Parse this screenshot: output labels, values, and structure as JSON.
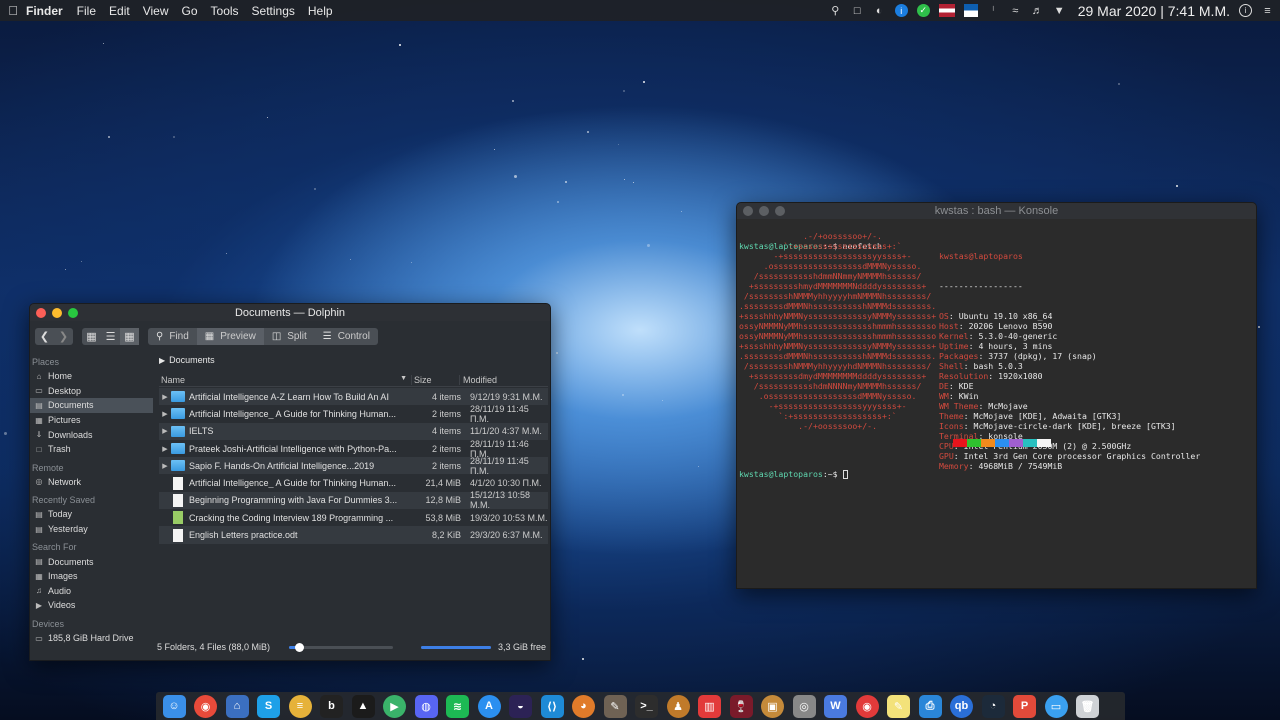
{
  "menubar": {
    "apple_icon": "apple-logo-icon",
    "app_name": "Finder",
    "menus": [
      "File",
      "Edit",
      "View",
      "Go",
      "Tools",
      "Settings",
      "Help"
    ],
    "date": "29 Mar 2020",
    "time": "7:41 M.M."
  },
  "dolphin": {
    "title": "Documents — Dolphin",
    "toolbar": {
      "find": "Find",
      "preview": "Preview",
      "split": "Split",
      "control": "Control"
    },
    "places_title": "Places",
    "places": [
      "Home",
      "Desktop",
      "Documents",
      "Pictures",
      "Downloads",
      "Trash"
    ],
    "remote_title": "Remote",
    "remote": [
      "Network"
    ],
    "recent_title": "Recently Saved",
    "recent": [
      "Today",
      "Yesterday"
    ],
    "search_title": "Search For",
    "search": [
      "Documents",
      "Images",
      "Audio",
      "Videos"
    ],
    "devices_title": "Devices",
    "devices": [
      "185,8 GiB Hard Drive"
    ],
    "breadcrumb": "Documents",
    "columns": {
      "name": "Name",
      "size": "Size",
      "modified": "Modified"
    },
    "rows": [
      {
        "name": "Artificial Intelligence A-Z Learn How To Build An AI",
        "size": "4 items",
        "modified": "9/12/19 9:31 M.M.",
        "type": "folder"
      },
      {
        "name": "Artificial Intelligence_ A Guide for Thinking Human...",
        "size": "2 items",
        "modified": "28/11/19 11:45 Π.Μ.",
        "type": "folder"
      },
      {
        "name": "IELTS",
        "size": "4 items",
        "modified": "11/1/20 4:37 M.M.",
        "type": "folder"
      },
      {
        "name": "Prateek Joshi-Artificial Intelligence with Python-Pa...",
        "size": "2 items",
        "modified": "28/11/19 11:46 Π.Μ.",
        "type": "folder"
      },
      {
        "name": "Sapio F. Hands-On Artificial Intelligence...2019",
        "size": "2 items",
        "modified": "28/11/19 11:45 Π.Μ.",
        "type": "folder"
      },
      {
        "name": "Artificial Intelligence_ A Guide for Thinking Human...",
        "size": "21,4 MiB",
        "modified": "4/1/20 10:30 Π.Μ.",
        "type": "file"
      },
      {
        "name": "Beginning Programming with Java For Dummies 3...",
        "size": "12,8 MiB",
        "modified": "15/12/13 10:58 M.M.",
        "type": "file"
      },
      {
        "name": "Cracking the Coding Interview 189 Programming ...",
        "size": "53,8 MiB",
        "modified": "19/3/20 10:53 M.M.",
        "type": "book"
      },
      {
        "name": "English Letters practice.odt",
        "size": "8,2 KiB",
        "modified": "29/3/20 6:37 M.M.",
        "type": "file"
      }
    ],
    "status": "5 Folders, 4 Files (88,0 MiB)",
    "zoom_level": 0.1,
    "space_used": 1.0,
    "free": "3,3 GiB free"
  },
  "konsole": {
    "title": "kwstas : bash — Konsole",
    "prompt_user": "kwstas@laptoparos",
    "prompt_path": ":~$ ",
    "command": "neofetch",
    "logo": [
      "             .-/+oossssoo+/-.",
      "         `:+ssssssssssssssssss+:`",
      "       -+ssssssssssssssssssyyssss+-",
      "     .ossssssssssssssssssdMMMNysssso.",
      "   /ssssssssssshdmmNNmmyNMMMMhssssss/",
      "  +ssssssssshmydMMMMMMMNddddyssssssss+",
      " /sssssssshNMMMyhhyyyyhmNMMMNhssssssss/",
      ".ssssssssdMMMNhsssssssssshNMMMdssssssss.",
      "+sssshhhyNMMNyssssssssssssyNMMMysssssss+",
      "ossyNMMMNyMMhsssssssssssssshmmmhssssssso",
      "ossyNMMMNyMMhsssssssssssssshmmmhssssssso",
      "+sssshhhyNMMNyssssssssssssyNMMMysssssss+",
      ".ssssssssdMMMNhsssssssssshNMMMdssssssss.",
      " /sssssssshNMMMyhhyyyyhdNMMMNhssssssss/",
      "  +sssssssssdmydMMMMMMMMddddyssssssss+",
      "   /ssssssssssshdmNNNNmyNMMMMhssssss/",
      "    .ossssssssssssssssssdMMMNysssso.",
      "      -+sssssssssssssssssyyyssss+-",
      "        `:+ssssssssssssssssss+:`",
      "            .-/+oossssoo+/-."
    ],
    "host": "kwstas@laptoparos",
    "separator": "-----------------",
    "info": [
      {
        "key": "OS",
        "value": "Ubuntu 19.10 x86_64"
      },
      {
        "key": "Host",
        "value": "20206 Lenovo B590"
      },
      {
        "key": "Kernel",
        "value": "5.3.0-40-generic"
      },
      {
        "key": "Uptime",
        "value": "4 hours, 3 mins"
      },
      {
        "key": "Packages",
        "value": "3737 (dpkg), 17 (snap)"
      },
      {
        "key": "Shell",
        "value": "bash 5.0.3"
      },
      {
        "key": "Resolution",
        "value": "1920x1080"
      },
      {
        "key": "DE",
        "value": "KDE"
      },
      {
        "key": "WM",
        "value": "KWin"
      },
      {
        "key": "WM Theme",
        "value": "McMojave"
      },
      {
        "key": "Theme",
        "value": "McMojave [KDE], Adwaita [GTK3]"
      },
      {
        "key": "Icons",
        "value": "McMojave-circle-dark [KDE], breeze [GTK3]"
      },
      {
        "key": "Terminal",
        "value": "konsole"
      },
      {
        "key": "CPU",
        "value": "Intel Pentium 2030M (2) @ 2.500GHz"
      },
      {
        "key": "GPU",
        "value": "Intel 3rd Gen Core processor Graphics Controller"
      },
      {
        "key": "Memory",
        "value": "4968MiB / 7549MiB"
      }
    ],
    "palette": [
      "#e8141c",
      "#2fc22f",
      "#f08a1d",
      "#2b8ff0",
      "#a05fd0",
      "#29c0c0",
      "#f5f5f5"
    ]
  },
  "dock": [
    {
      "name": "finder",
      "icon": "finder-icon",
      "color": "#3a8fe8",
      "glyph": "☺"
    },
    {
      "name": "chrome",
      "icon": "chrome-icon",
      "color": "#e84a3a",
      "glyph": "◉"
    },
    {
      "name": "system-settings",
      "icon": "settings-app-icon",
      "color": "#3b6fc0",
      "glyph": "⌂"
    },
    {
      "name": "skype",
      "icon": "skype-icon",
      "color": "#1ea0e8",
      "glyph": "S"
    },
    {
      "name": "reader",
      "icon": "reader-icon",
      "color": "#e6b23a",
      "glyph": "≡"
    },
    {
      "name": "dark-app",
      "icon": "app-icon",
      "color": "#222",
      "glyph": "b"
    },
    {
      "name": "inkscape",
      "icon": "inkscape-icon",
      "color": "#1b1b1b",
      "glyph": "▲"
    },
    {
      "name": "media-player",
      "icon": "play-icon",
      "color": "#3ab36a",
      "glyph": "▶"
    },
    {
      "name": "discord",
      "icon": "discord-icon",
      "color": "#5865f2",
      "glyph": "◍"
    },
    {
      "name": "spotify",
      "icon": "spotify-icon",
      "color": "#1db954",
      "glyph": "≋"
    },
    {
      "name": "app-store",
      "icon": "app-store-icon",
      "color": "#2b8ff0",
      "glyph": "A"
    },
    {
      "name": "eclipse",
      "icon": "eclipse-icon",
      "color": "#2c2255",
      "glyph": "◒"
    },
    {
      "name": "vscode",
      "icon": "vscode-icon",
      "color": "#1e8ad6",
      "glyph": "⟨⟩"
    },
    {
      "name": "color-picker",
      "icon": "palette-icon",
      "color": "#e07b2a",
      "glyph": "◕"
    },
    {
      "name": "gimp",
      "icon": "gimp-icon",
      "color": "#6f6254",
      "glyph": "✎"
    },
    {
      "name": "terminal",
      "icon": "terminal-icon",
      "color": "#2d2d2d",
      "glyph": ">_"
    },
    {
      "name": "joystick",
      "icon": "game-icon",
      "color": "#c07a2a",
      "glyph": "♟"
    },
    {
      "name": "popcorn",
      "icon": "popcorn-icon",
      "color": "#e23a3a",
      "glyph": "▥"
    },
    {
      "name": "wine",
      "icon": "wine-icon",
      "color": "#7a1a2a",
      "glyph": "🍷"
    },
    {
      "name": "archive",
      "icon": "archive-icon",
      "color": "#c58a3a",
      "glyph": "▣"
    },
    {
      "name": "disk-utility",
      "icon": "disk-icon",
      "color": "#888",
      "glyph": "◎"
    },
    {
      "name": "word",
      "icon": "word-icon",
      "color": "#4a7ae0",
      "glyph": "W"
    },
    {
      "name": "reader-red",
      "icon": "eye-icon",
      "color": "#e23a3a",
      "glyph": "◉"
    },
    {
      "name": "notes",
      "icon": "notes-icon",
      "color": "#f3e27a",
      "glyph": "✎"
    },
    {
      "name": "scanner",
      "icon": "scanner-icon",
      "color": "#2a86d8",
      "glyph": "⎙"
    },
    {
      "name": "qbittorrent",
      "icon": "qbittorrent-icon",
      "color": "#2a6fd8",
      "glyph": "qb"
    },
    {
      "name": "system-monitor",
      "icon": "monitor-icon",
      "color": "#1c2a3a",
      "glyph": "◔"
    },
    {
      "name": "pdf-tool",
      "icon": "pdf-icon",
      "color": "#e24a3a",
      "glyph": "P"
    },
    {
      "name": "folder",
      "icon": "folder-icon",
      "color": "#3aa0f0",
      "glyph": "▭"
    },
    {
      "name": "trash",
      "icon": "trash-icon",
      "color": "#cfd2d6",
      "glyph": "🗑"
    }
  ]
}
